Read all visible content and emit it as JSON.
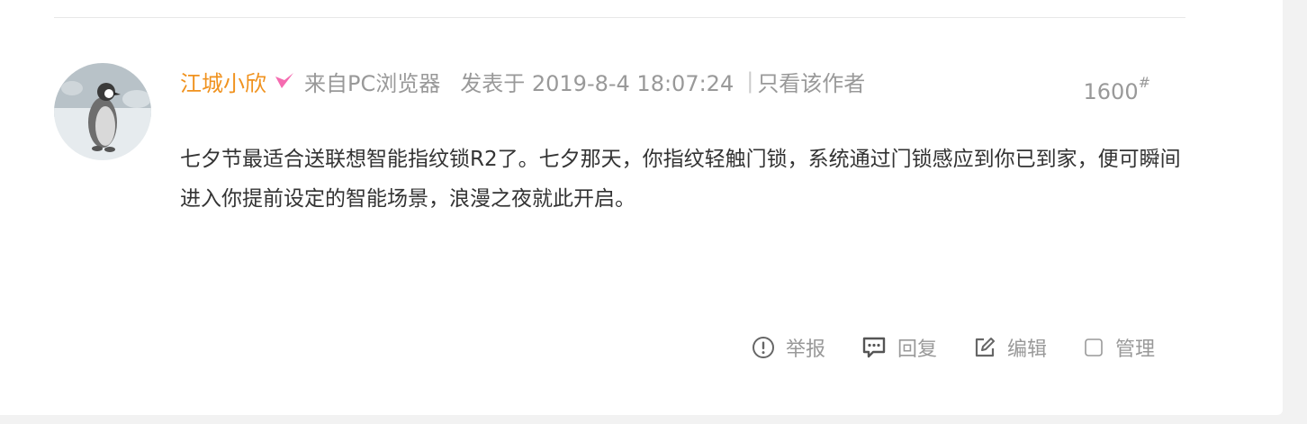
{
  "post": {
    "author": "江城小欣",
    "source": "来自PC浏览器",
    "post_time": "发表于 2019-8-4 18:07:24",
    "separator": "|",
    "only_author": "只看该作者",
    "floor_number": "1600",
    "floor_mark": "#",
    "content": "七夕节最适合送联想智能指纹锁R2了。七夕那天，你指纹轻触门锁，系统通过门锁感应到你已到家，便可瞬间进入你提前设定的智能场景，浪漫之夜就此开启。"
  },
  "actions": {
    "report": "举报",
    "reply": "回复",
    "edit": "编辑",
    "manage": "管理"
  },
  "icons": {
    "badge": "verified-v-icon",
    "report": "alert-circle-icon",
    "reply": "comment-icon",
    "edit": "edit-icon",
    "manage": "checkbox-icon"
  },
  "colors": {
    "author": "#f0921e",
    "badge": "#f56bb0",
    "meta": "#999999",
    "content": "#333333"
  }
}
